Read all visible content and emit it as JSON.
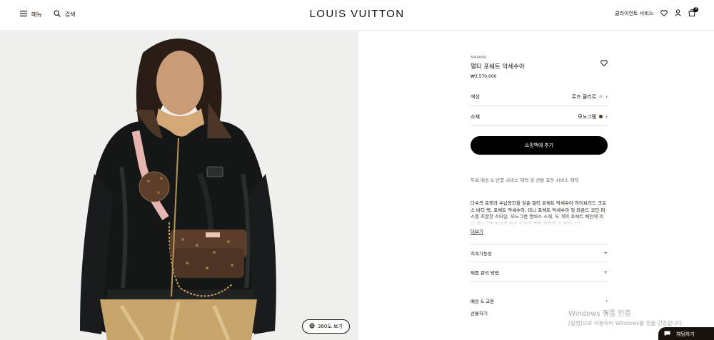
{
  "header": {
    "menu_label": "메뉴",
    "search_label": "검색",
    "logo": "LOUIS VUITTON",
    "client_service_label": "클라이언트 서비스",
    "cart_count": "0"
  },
  "hero": {
    "view360_label": "360도 보기"
  },
  "product": {
    "sku": "M44840",
    "name": "멀티 포쉐트 악세수아",
    "price": "₩3,570,000",
    "options": [
      {
        "label": "색상",
        "value": "로즈 클리르",
        "swatch": "#e9c7c6"
      },
      {
        "label": "소재",
        "value": "모노그램",
        "swatch": "#4a3426"
      }
    ],
    "add_to_cart": "쇼핑백에 추가",
    "service_text": "무료 배송 & 반품 서비스 혜택 및 선물 포장 서비스 혜택",
    "description": "다수의 포켓과 수납공간을 갖춘 멀티 포쉐트 악세수아 하이브리드 크로스 바디 백. 포쉐트 악세수아, 미니 포쉐트 악세수아 및 라운드 코인 퍼스를 조합한 스타일. 모노그램 캔버스 소재, 두 개의 포쉐트 체인에 미니 모노그램 파우치 퍼스 디자인 백을 연출할 수 있습니다.",
    "more_label": "더보기",
    "accordions": [
      "지속가능성",
      "제품 관리 방법"
    ],
    "links": [
      "배송 & 교환",
      "선물하기"
    ]
  },
  "watermark": {
    "line1": "Windows 정품 인증",
    "line2": "[설정]으로 이동하여 Windows를 정품 인증합니다."
  },
  "chat": {
    "label": "채팅하기"
  }
}
